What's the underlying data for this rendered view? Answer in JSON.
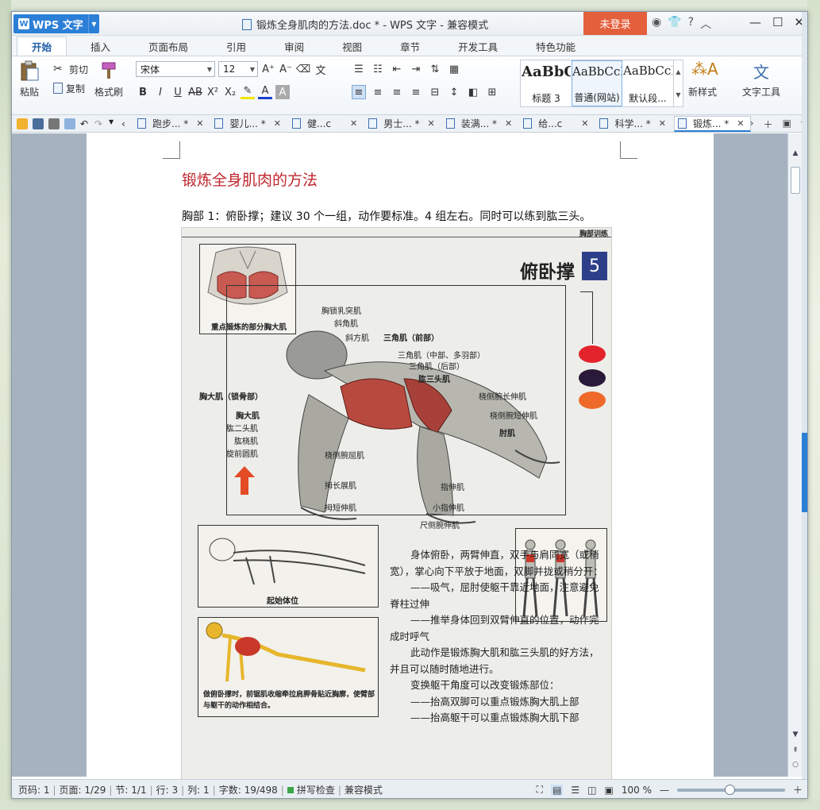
{
  "titlebar": {
    "app_label": "WPS 文字",
    "doc_title": "锻炼全身肌肉的方法.doc * - WPS 文字 - 兼容模式",
    "login_label": "未登录"
  },
  "ribbon_tabs": [
    "开始",
    "插入",
    "页面布局",
    "引用",
    "审阅",
    "视图",
    "章节",
    "开发工具",
    "特色功能"
  ],
  "ribbon": {
    "paste_label": "粘贴",
    "cut_label": "剪切",
    "copy_label": "复制",
    "format_painter_label": "格式刷",
    "font_name": "宋体",
    "font_size": "12",
    "styles": [
      {
        "sample": "AaBbC",
        "name": "标题 3"
      },
      {
        "sample": "AaBbCcDd",
        "name": "普通(网站)"
      },
      {
        "sample": "AaBbCcDd",
        "name": "默认段..."
      }
    ],
    "new_style_label": "新样式",
    "text_tools_label": "文字工具"
  },
  "doc_tabs": [
    {
      "label": "跑步... *",
      "active": false
    },
    {
      "label": "婴儿... *",
      "active": false
    },
    {
      "label": "健...c",
      "active": false
    },
    {
      "label": "男士... *",
      "active": false
    },
    {
      "label": "装满... *",
      "active": false
    },
    {
      "label": "给...c",
      "active": false
    },
    {
      "label": "科学... *",
      "active": false
    },
    {
      "label": "锻炼... *",
      "active": true
    }
  ],
  "document": {
    "title": "锻炼全身肌肉的方法",
    "paragraph": "胸部 1：俯卧撑；建议 30 个一组，动作要标准。4 组左右。同时可以练到肱三头。",
    "figure": {
      "header_label": "胸部训练",
      "title": "俯卧撑",
      "number": "5",
      "inset_caption": "重点锻炼的部分胸大肌",
      "muscle_labels": [
        "胸锁乳突肌",
        "斜角肌",
        "斜方肌",
        "三角肌（前部）",
        "三角肌（中部、多羽部）",
        "三角肌（后部）",
        "肱三头肌",
        "桡侧腕长伸肌",
        "桡侧腕短伸肌",
        "肘肌",
        "胸大肌（锁骨部）",
        "胸大肌",
        "肱二头肌",
        "肱桡肌",
        "旋前圆肌",
        "桡侧腕屈肌",
        "拇长展肌",
        "拇短伸肌",
        "指伸肌",
        "小指伸肌",
        "尺侧腕伸肌"
      ],
      "start_position_label": "起始体位",
      "skeleton_caption": "做俯卧撑时，前锯肌收缩牵拉肩胛骨贴近胸廓，使臂部与躯干的动作相结合。",
      "description": [
        "身体俯卧，两臂伸直，双手与肩同宽（或稍宽），掌心向下平放于地面，双脚并拢或稍分开：",
        "——吸气，屈肘使躯干靠近地面，注意避免脊柱过伸",
        "——推举身体回到双臂伸直的位置，动作完成时呼气",
        "此动作是锻炼胸大肌和肱三头肌的好方法，并且可以随时随地进行。",
        "变换躯干角度可以改变锻炼部位：",
        "——抬高双脚可以重点锻炼胸大肌上部",
        "——抬高躯干可以重点锻炼胸大肌下部"
      ]
    }
  },
  "statusbar": {
    "page_code": "页码: 1",
    "page": "页面: 1/29",
    "section": "节: 1/1",
    "row": "行: 3",
    "column": "列: 1",
    "word_count": "字数: 19/498",
    "spell_check": "拼写检查",
    "compat_mode": "兼容模式",
    "zoom": "100 %"
  },
  "colors": {
    "accent": "#2c7fd6",
    "login": "#e45f3c",
    "title_red": "#c0262d",
    "figure_badge": "#2e3f8a",
    "dot_red": "#e4242c",
    "dot_dark": "#2a1a3a",
    "dot_orange": "#ef6a2a"
  }
}
